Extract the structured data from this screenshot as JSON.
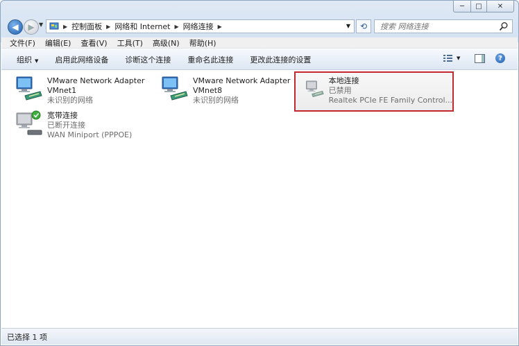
{
  "titlebar": {
    "minimize": "─",
    "maximize": "□",
    "close": "✕"
  },
  "address": {
    "crumbs": [
      "控制面板",
      "网络和 Internet",
      "网络连接"
    ],
    "search_placeholder": "搜索 网络连接"
  },
  "menubar": {
    "items": [
      "文件(F)",
      "编辑(E)",
      "查看(V)",
      "工具(T)",
      "高级(N)",
      "帮助(H)"
    ]
  },
  "commandbar": {
    "organize": "组织",
    "items": [
      "启用此网络设备",
      "诊断这个连接",
      "重命名此连接",
      "更改此连接的设置"
    ]
  },
  "connections": [
    {
      "name": "VMware Network Adapter VMnet1",
      "line1": "VMware Network Adapter",
      "line2": "VMnet1",
      "line3": "未识别的网络",
      "icon": "network-adapter-icon",
      "state": "connected"
    },
    {
      "name": "VMware Network Adapter VMnet8",
      "line1": "VMware Network Adapter",
      "line2": "VMnet8",
      "line3": "未识别的网络",
      "icon": "network-adapter-icon",
      "state": "connected"
    },
    {
      "name": "本地连接",
      "line1": "本地连接",
      "line2": "已禁用",
      "line3": "Realtek PCIe FE Family Control...",
      "icon": "network-adapter-disabled-icon",
      "state": "disabled",
      "selected": true
    },
    {
      "name": "宽带连接",
      "line1": "宽带连接",
      "line2": "已断开连接",
      "line3": "WAN Miniport (PPPOE)",
      "icon": "broadband-icon",
      "state": "disconnected"
    }
  ],
  "statusbar": {
    "text": "已选择 1 项"
  },
  "colors": {
    "selection_outline": "#c2262e",
    "accent": "#1d5fb0"
  }
}
